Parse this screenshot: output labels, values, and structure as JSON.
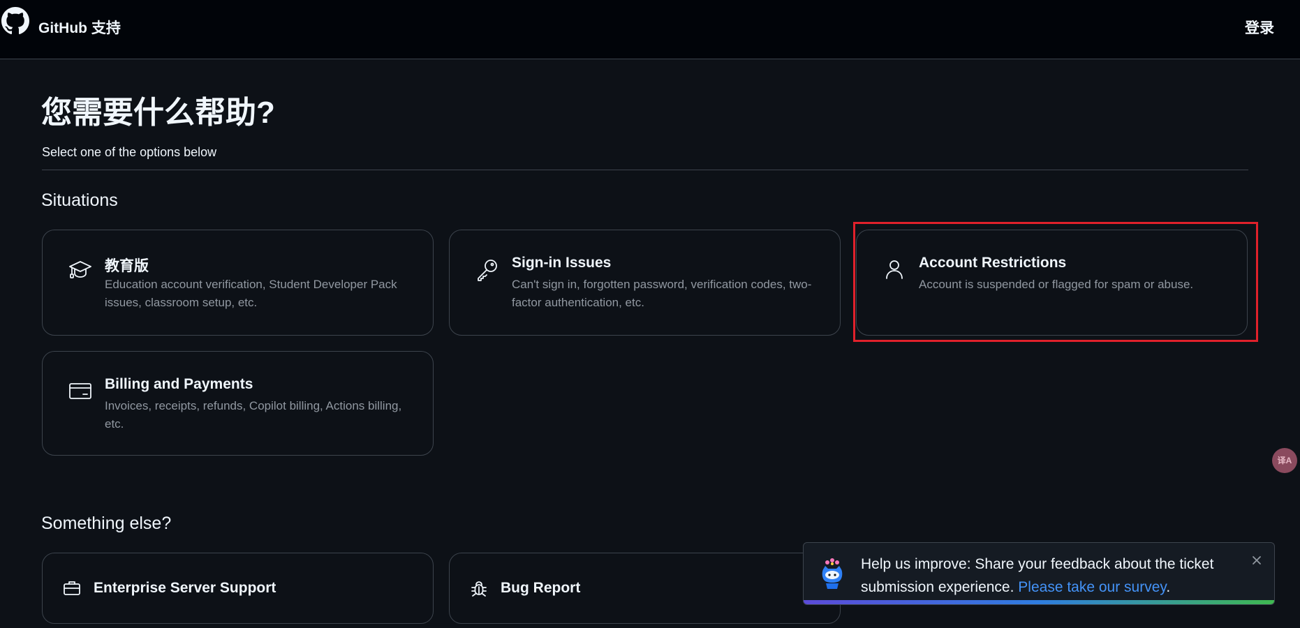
{
  "header": {
    "brand": "GitHub 支持",
    "signin_label": "登录"
  },
  "page": {
    "title": "您需要什么帮助?",
    "subtitle": "Select one of the options below"
  },
  "situations": {
    "heading": "Situations",
    "cards": [
      {
        "title": "教育版",
        "description": "Education account verification, Student Developer Pack issues, classroom setup, etc.",
        "icon": "mortarboard-icon"
      },
      {
        "title": "Sign-in Issues",
        "description": "Can't sign in, forgotten password, verification codes, two-factor authentication, etc.",
        "icon": "key-icon"
      },
      {
        "title": "Account Restrictions",
        "description": "Account is suspended or flagged for spam or abuse.",
        "icon": "person-icon"
      },
      {
        "title": "Billing and Payments",
        "description": "Invoices, receipts, refunds, Copilot billing, Actions billing, etc.",
        "icon": "credit-card-icon"
      }
    ]
  },
  "something_else": {
    "heading": "Something else?",
    "cards": [
      {
        "title": "Enterprise Server Support",
        "icon": "briefcase-icon"
      },
      {
        "title": "Bug Report",
        "icon": "bug-icon"
      }
    ]
  },
  "toast": {
    "message": "Help us improve: Share your feedback about the ticket submission experience.",
    "link_text": "Please take our survey",
    "trailing": "."
  },
  "translate_widget": {
    "label": "译A"
  },
  "colors": {
    "background": "#0d1117",
    "header_background": "#010409",
    "border": "#3d444d",
    "muted_text": "#9198a1",
    "link": "#4493f8",
    "highlight": "#e0212b"
  }
}
